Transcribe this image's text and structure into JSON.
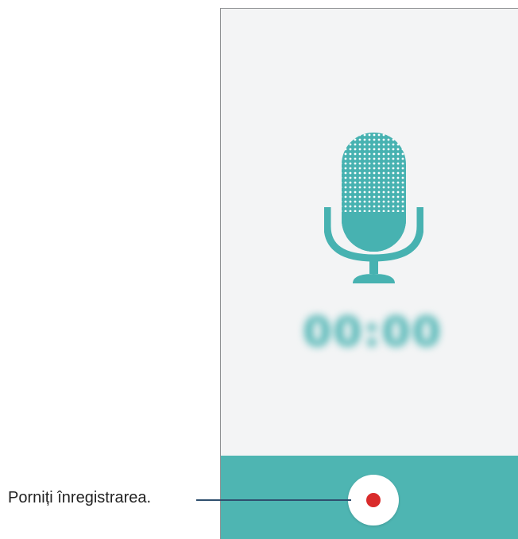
{
  "screen": {
    "timer": "00:00",
    "mic_icon": "microphone-icon",
    "record_button_icon": "record-dot-icon",
    "colors": {
      "accent": "#4eb5b2",
      "record": "#d92b2b",
      "background": "#f3f4f5"
    }
  },
  "callout": {
    "label": "Porniți înregistrarea."
  }
}
